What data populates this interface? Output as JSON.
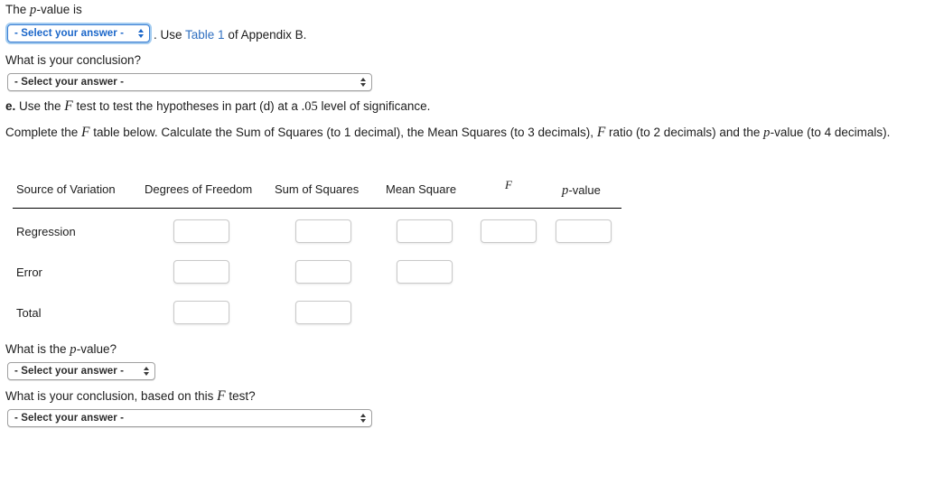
{
  "questions": {
    "p_value_prompt_pre": "The ",
    "p_value_prompt_var": "p",
    "p_value_prompt_post": "-value is",
    "use_table_pre": ". Use ",
    "use_table_link": "Table 1",
    "use_table_post": " of Appendix B.",
    "conclusion_prompt": "What is your conclusion?",
    "part_e_letter": "e.",
    "part_e_pre": " Use the ",
    "part_e_var": "F",
    "part_e_mid": " test to test the hypotheses in part (d) at a ",
    "part_e_level": ".05",
    "part_e_post": " level of significance.",
    "instructions_pre": "Complete the ",
    "instructions_var_f1": "F",
    "instructions_mid1": " table below. Calculate the Sum of Squares (to 1 decimal), the Mean Squares (to 3 decimals), ",
    "instructions_var_f2": "F",
    "instructions_mid2": " ratio (to 2 decimals) and the ",
    "instructions_var_p": "p",
    "instructions_post": "-value (to 4 decimals).",
    "final_p_value_pre": "What is the ",
    "final_p_value_var": "p",
    "final_p_value_post": "-value?",
    "final_conclusion_pre": "What is your conclusion, based on this ",
    "final_conclusion_var": "F",
    "final_conclusion_post": " test?"
  },
  "selects": {
    "p_value_select": {
      "value": "- Select your answer -",
      "state": "focused"
    },
    "conclusion_select": {
      "value": "- Select your answer -",
      "state": "normal"
    },
    "final_p_value_select": {
      "value": "- Select your answer -",
      "state": "normal"
    },
    "final_conclusion_select": {
      "value": "- Select your answer -",
      "state": "normal"
    }
  },
  "anova_table": {
    "headers": [
      "Source of Variation",
      "Degrees of Freedom",
      "Sum of Squares",
      "Mean Square",
      "F",
      "p-value"
    ],
    "header_f": "F",
    "header_p_var": "p",
    "header_p_rest": "-value",
    "rows": [
      {
        "label": "Regression",
        "inputs": [
          "",
          "",
          "",
          "",
          ""
        ]
      },
      {
        "label": "Error",
        "inputs": [
          "",
          "",
          ""
        ]
      },
      {
        "label": "Total",
        "inputs": [
          "",
          ""
        ]
      }
    ]
  },
  "colors": {
    "link": "#2f6fc0",
    "focus_ring": "#56a0e3",
    "focus_text": "#1a66c9",
    "rule": "#000000",
    "input_border": "#c9c9c9"
  }
}
